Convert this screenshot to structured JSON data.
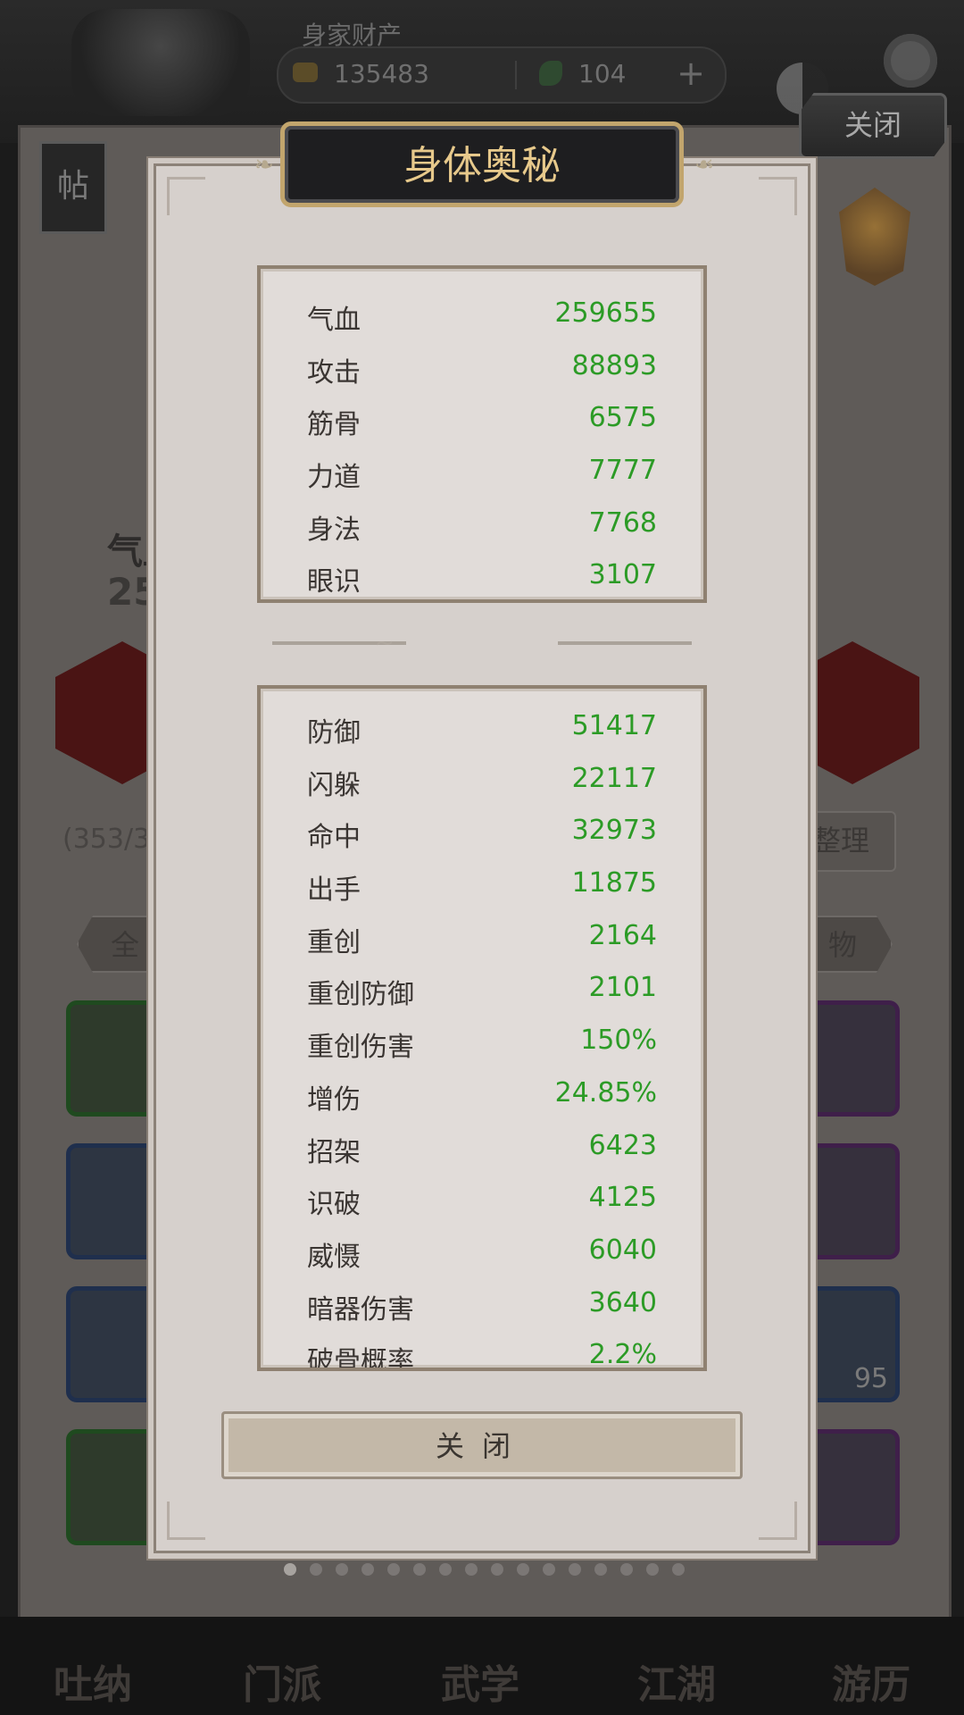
{
  "header": {
    "wealth_label": "身家财产",
    "coins": "135483",
    "jade": "104",
    "plus": "+",
    "close_tab_label": "关闭"
  },
  "background": {
    "side_tag": "帖",
    "stat_label": "气血",
    "stat_value": "259655",
    "bag_count": "(353/38",
    "sort_label": "整理",
    "filter_all": "全",
    "filter_item": "物",
    "slot_count": "95",
    "nav": [
      "吐纳",
      "门派",
      "武学",
      "江湖",
      "游历"
    ]
  },
  "modal": {
    "title": "身体奥秘",
    "close_label": "关闭",
    "primary_stats": [
      {
        "name": "气血",
        "value": "259655"
      },
      {
        "name": "攻击",
        "value": "88893"
      },
      {
        "name": "筋骨",
        "value": "6575"
      },
      {
        "name": "力道",
        "value": "7777"
      },
      {
        "name": "身法",
        "value": "7768"
      },
      {
        "name": "眼识",
        "value": "3107"
      }
    ],
    "secondary_stats": [
      {
        "name": "防御",
        "value": "51417"
      },
      {
        "name": "闪躲",
        "value": "22117"
      },
      {
        "name": "命中",
        "value": "32973"
      },
      {
        "name": "出手",
        "value": "11875"
      },
      {
        "name": "重创",
        "value": "2164"
      },
      {
        "name": "重创防御",
        "value": "2101"
      },
      {
        "name": "重创伤害",
        "value": "150%"
      },
      {
        "name": "增伤",
        "value": "24.85%"
      },
      {
        "name": "招架",
        "value": "6423"
      },
      {
        "name": "识破",
        "value": "4125"
      },
      {
        "name": "威慑",
        "value": "6040"
      },
      {
        "name": "暗器伤害",
        "value": "3640"
      },
      {
        "name": "破骨概率",
        "value": "2.2%"
      }
    ]
  },
  "colors": {
    "stat_value": "#2c9b26",
    "title_text": "#e7c98b",
    "modal_bg": "#d6d0cc"
  },
  "pager": {
    "total": 16,
    "active": 0
  }
}
